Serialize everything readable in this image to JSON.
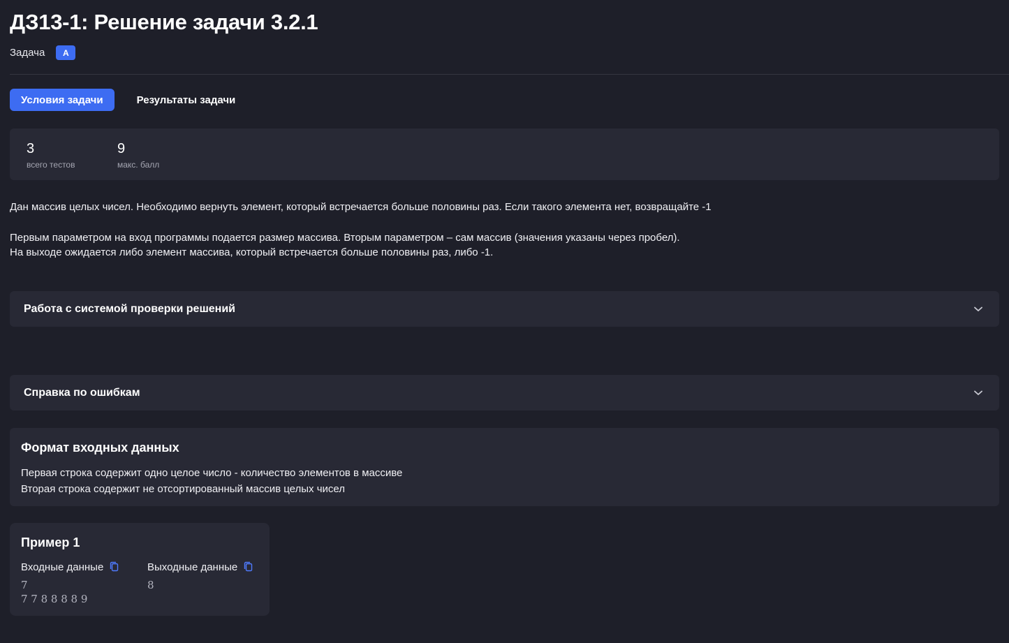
{
  "header": {
    "title": "ДЗ13-1: Решение задачи 3.2.1",
    "subtitle": "Задача",
    "badge": "A"
  },
  "tabs": [
    {
      "label": "Условия задачи",
      "active": true
    },
    {
      "label": "Результаты задачи",
      "active": false
    }
  ],
  "stats": [
    {
      "value": "3",
      "label": "всего тестов"
    },
    {
      "value": "9",
      "label": "макс. балл"
    }
  ],
  "description": {
    "p1": "Дан массив целых чисел. Необходимо вернуть элемент, который встречается больше половины раз. Если такого элемента нет, возвращайте -1",
    "p2": "Первым параметром на вход программы подается размер массива. Вторым параметром – сам массив (значения указаны через пробел).",
    "p3": "На выходе ожидается либо элемент массива, который встречается больше половины раз, либо -1."
  },
  "accordions": [
    {
      "title": "Работа с системой проверки решений",
      "icon": "chevron-down-icon"
    },
    {
      "title": "Справка по ошибкам",
      "icon": "chevron-down-icon"
    }
  ],
  "format": {
    "title": "Формат входных данных",
    "lines": [
      "Первая строка содержит одно целое число - количество элементов в массиве",
      "Вторая строка содержит не отсортированный массив целых чисел"
    ]
  },
  "example": {
    "title": "Пример 1",
    "input_label": "Входные данные",
    "output_label": "Выходные данные",
    "input_lines": [
      "7",
      "7 7 8 8 8 8 9"
    ],
    "output_lines": [
      "8"
    ],
    "copy_icon": "copy-icon"
  },
  "colors": {
    "background": "#1e1f29",
    "panel": "#282935",
    "accent": "#3d6cf2",
    "muted": "#a4a5b1"
  }
}
